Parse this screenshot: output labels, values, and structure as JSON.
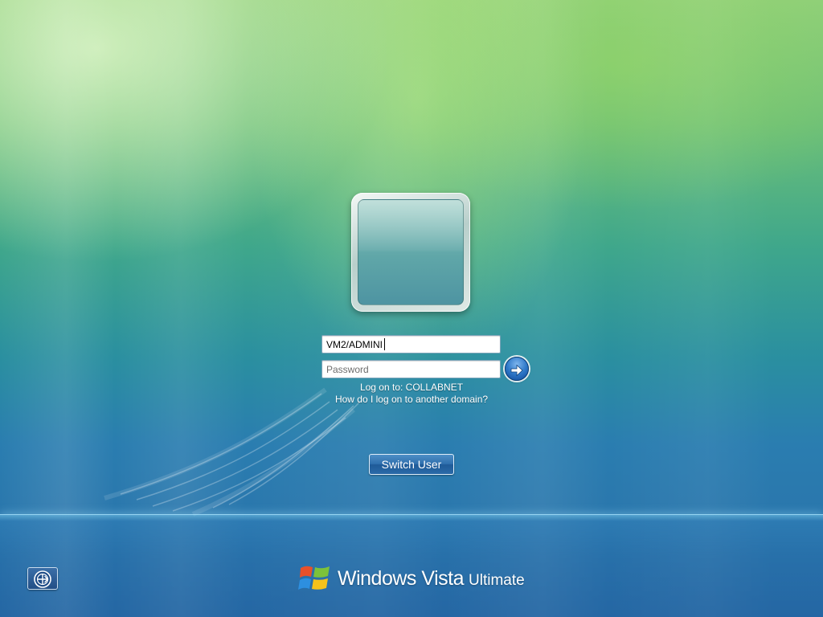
{
  "login": {
    "username_value": "VM2/ADMINI",
    "password_placeholder": "Password",
    "logon_to_text": "Log on to: COLLABNET",
    "domain_help_link": "How do I log on to another domain?",
    "switch_user_label": "Switch User"
  },
  "branding": {
    "product_name": "Windows Vista",
    "edition": "Ultimate"
  },
  "icons": {
    "submit": "arrow-right-icon",
    "accessibility": "ease-of-access-icon",
    "logo": "windows-flag-icon",
    "user_picture": "user-tile"
  },
  "colors": {
    "background_top": "#8fcf7a",
    "background_bottom": "#2a6ea8",
    "button_blue": "#2f6fae",
    "text": "#ffffff"
  }
}
